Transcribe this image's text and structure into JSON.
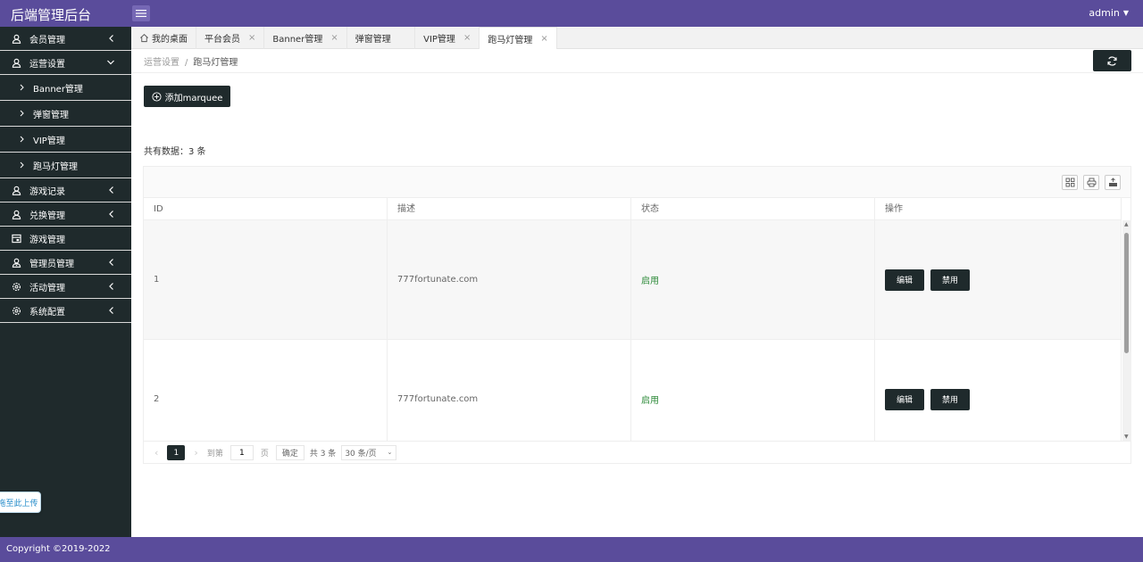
{
  "app": {
    "title": "后端管理后台",
    "user": "admin"
  },
  "sidebar": {
    "items": [
      {
        "label": "会员管理",
        "icon": "user-icon"
      },
      {
        "label": "运营设置",
        "icon": "user-icon",
        "expanded": true
      },
      {
        "label": "游戏记录",
        "icon": "user-icon"
      },
      {
        "label": "兑换管理",
        "icon": "user-icon"
      },
      {
        "label": "游戏管理",
        "icon": "table-icon"
      },
      {
        "label": "管理员管理",
        "icon": "admin-icon"
      },
      {
        "label": "活动管理",
        "icon": "gear-icon"
      },
      {
        "label": "系统配置",
        "icon": "gear-icon"
      }
    ],
    "subitems": [
      {
        "label": "Banner管理"
      },
      {
        "label": "弹窗管理"
      },
      {
        "label": "VIP管理"
      },
      {
        "label": "跑马灯管理"
      }
    ],
    "upload_tip": "拖至此上传"
  },
  "tabs": [
    {
      "label": "我的桌面",
      "closable": false
    },
    {
      "label": "平台会员",
      "closable": true
    },
    {
      "label": "Banner管理",
      "closable": true
    },
    {
      "label": "弹窗管理",
      "closable": false
    },
    {
      "label": "VIP管理",
      "closable": true
    },
    {
      "label": "跑马灯管理",
      "closable": true,
      "active": true
    }
  ],
  "breadcrumb": {
    "parent": "运营设置",
    "separator": "/",
    "current": "跑马灯管理"
  },
  "actions": {
    "add_label": "添加marquee"
  },
  "count_text": "共有数据：3 条",
  "table": {
    "columns": [
      "ID",
      "描述",
      "状态",
      "操作"
    ],
    "rows": [
      {
        "id": "1",
        "desc": "777fortunate.com",
        "status": "启用",
        "edit": "编辑",
        "disable": "禁用"
      },
      {
        "id": "2",
        "desc": "777fortunate.com",
        "status": "启用",
        "edit": "编辑",
        "disable": "禁用"
      }
    ]
  },
  "pager": {
    "current_page": "1",
    "goto_label": "到第",
    "goto_value": "1",
    "page_label": "页",
    "confirm": "确定",
    "total": "共 3 条",
    "page_size": "30 条/页"
  },
  "footer": {
    "copyright": "Copyright ©2019-2022"
  },
  "colors": {
    "brand": "#5a4c9b",
    "dark": "#1f2a2c",
    "status_enabled": "#2e8b3a"
  }
}
